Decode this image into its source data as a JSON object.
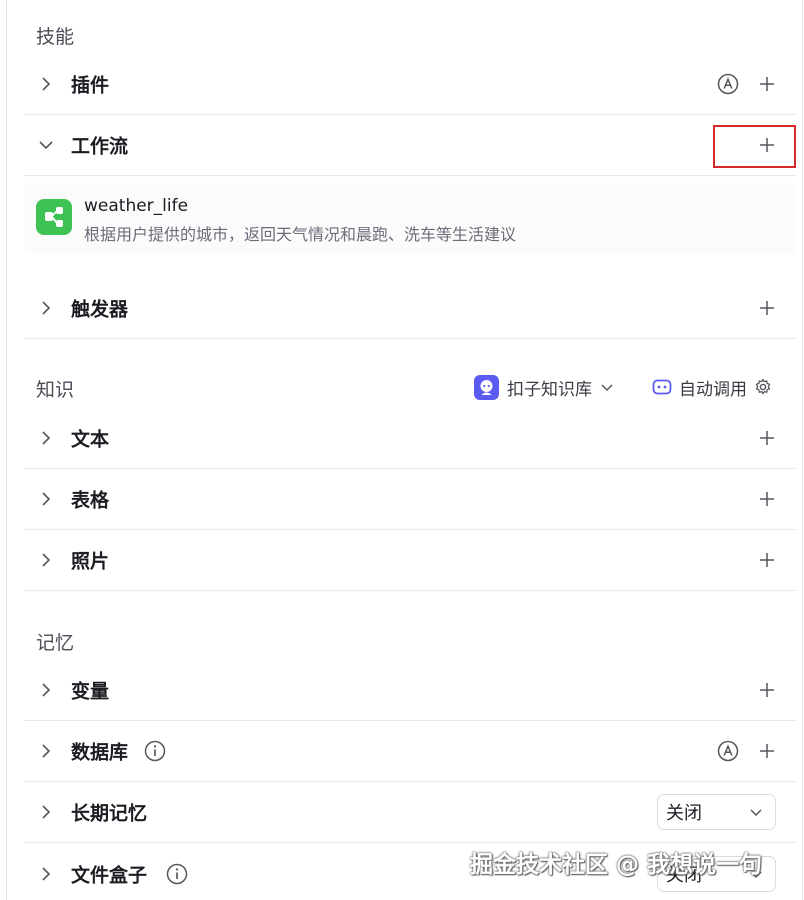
{
  "skills": {
    "heading": "技能",
    "plugin": {
      "label": "插件"
    },
    "workflow": {
      "label": "工作流"
    },
    "trigger": {
      "label": "触发器"
    }
  },
  "workflow_item": {
    "name": "weather_life",
    "description": "根据用户提供的城市，返回天气情况和晨跑、洗车等生活建议"
  },
  "knowledge": {
    "heading": "知识",
    "kb_selector": "扣子知识库",
    "auto_call": "自动调用",
    "text": {
      "label": "文本"
    },
    "table": {
      "label": "表格"
    },
    "photo": {
      "label": "照片"
    }
  },
  "memory": {
    "heading": "记忆",
    "variable": {
      "label": "变量"
    },
    "database": {
      "label": "数据库"
    },
    "long_term": {
      "label": "长期记忆",
      "value": "关闭"
    },
    "file_box": {
      "label": "文件盒子",
      "value": "关闭"
    }
  },
  "watermark": "掘金技术社区 @ 我想说一句",
  "colors": {
    "highlight": "#d42a2a",
    "workflow_logo": "#3ec254",
    "kb_logo": "#5b5bf2"
  }
}
